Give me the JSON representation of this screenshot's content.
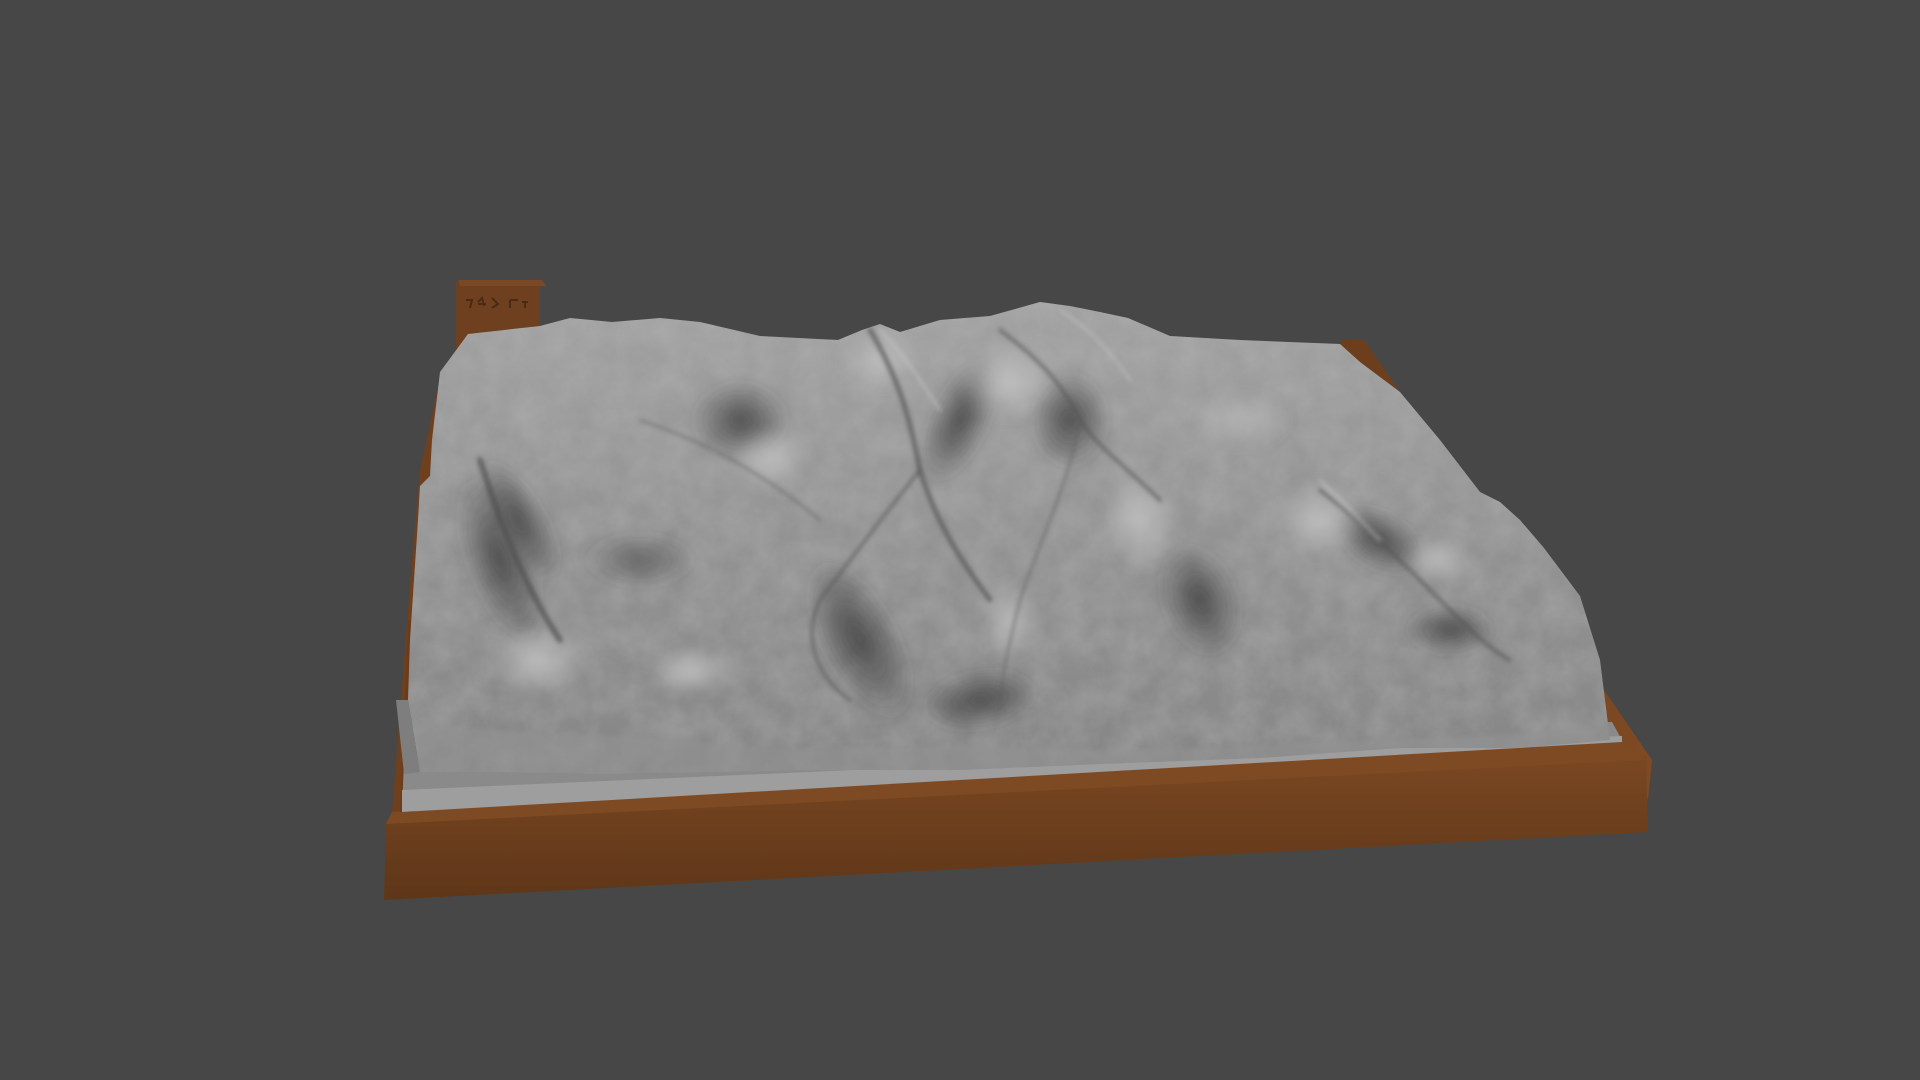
{
  "scene": {
    "background_color": "#474747",
    "base_color": "#6a3f1e",
    "base_top_color": "#7a4a24",
    "terrain_color": "#8f8f8f",
    "terrain_shadow_color": "#4e4e4e",
    "terrain_highlight_color": "#b6b6b6",
    "border_color": "#999999",
    "objects": [
      {
        "name": "terrain-relief-model",
        "icon": "terrain-mesh"
      },
      {
        "name": "wooden-base-plate",
        "icon": "base-plate"
      },
      {
        "name": "corner-label-block",
        "icon": "label-block"
      }
    ]
  }
}
